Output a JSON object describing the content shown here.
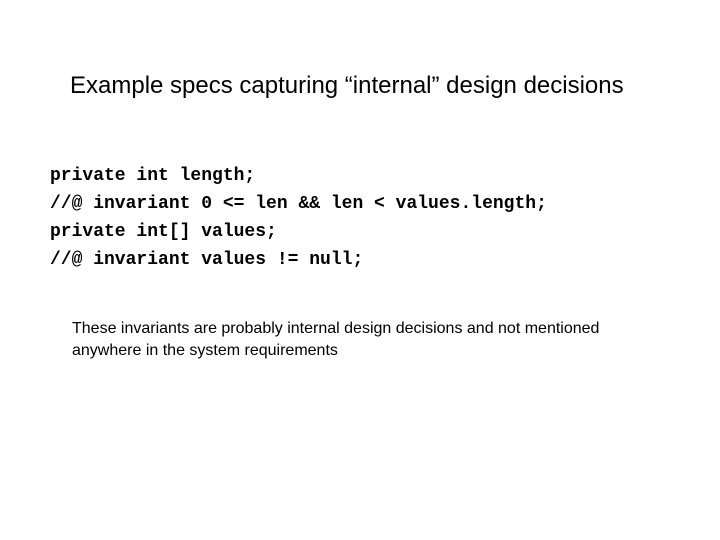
{
  "slide": {
    "title": "Example specs capturing “internal” design decisions",
    "code": "private int length;\n//@ invariant 0 <= len && len < values.length;\nprivate int[] values;\n//@ invariant values != null;",
    "body": "These invariants are probably internal design decisions and not mentioned anywhere in the system requirements"
  }
}
